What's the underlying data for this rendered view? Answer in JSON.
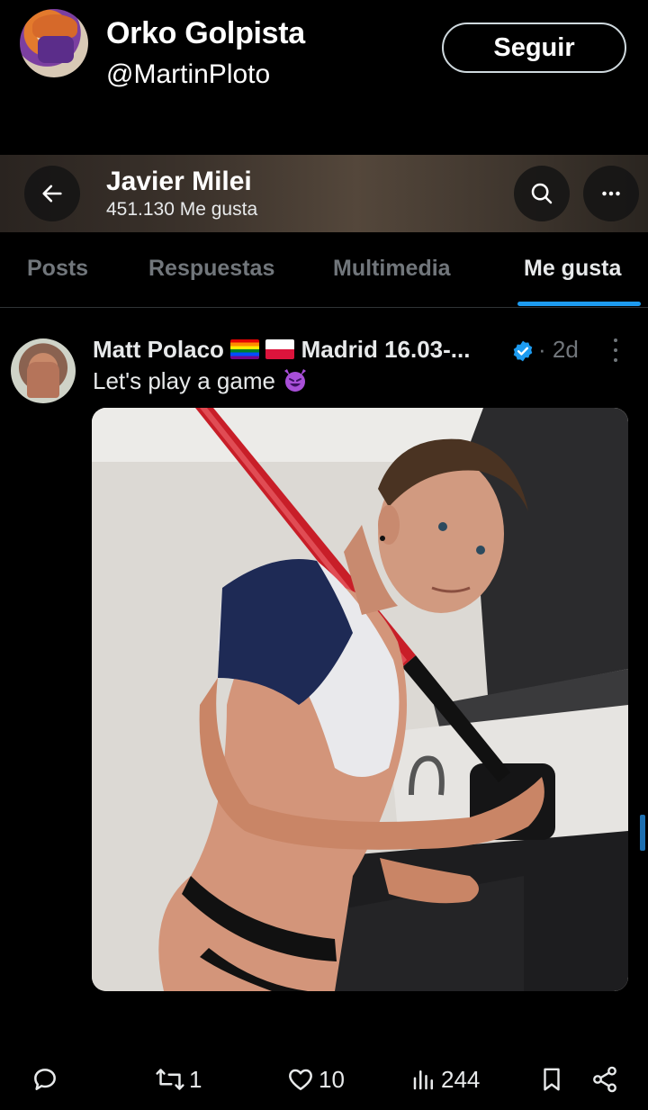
{
  "outer_tweet": {
    "author_name": "Orko Golpista",
    "author_handle": "@MartinPloto",
    "follow_label": "Seguir"
  },
  "profile": {
    "name": "Javier Milei",
    "subtitle": "451.130 Me gusta"
  },
  "tabs": [
    {
      "label": "Posts",
      "active": false
    },
    {
      "label": "Respuestas",
      "active": false
    },
    {
      "label": "Multimedia",
      "active": false
    },
    {
      "label": "Me gusta",
      "active": true
    }
  ],
  "tweet": {
    "author_name_before_flags": "Matt Polaco",
    "author_name_after_flags": "Madrid 16.03-...",
    "time": "· 2d",
    "text": "Let's play a game",
    "verified": true
  },
  "actions": {
    "reply_count": "",
    "retweet_count": "1",
    "like_count": "10",
    "views_count": "244"
  },
  "colors": {
    "accent": "#1d9bf0",
    "muted": "#71767b",
    "text": "#e7e9ea"
  }
}
